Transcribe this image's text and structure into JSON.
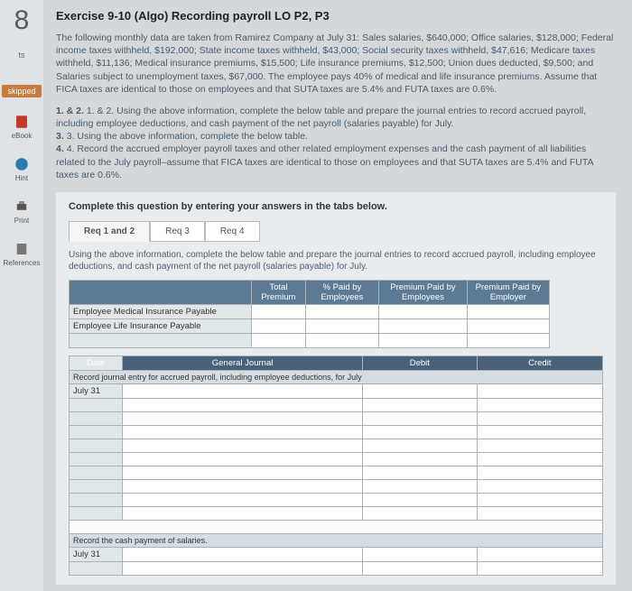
{
  "sidebar": {
    "question_number": "8",
    "points": "ts",
    "badge": "skipped",
    "ebook_label": "eBook",
    "hint_label": "Hint",
    "print_label": "Print",
    "references_label": "References"
  },
  "title": "Exercise 9-10 (Algo) Recording payroll LO P2, P3",
  "intro": "The following monthly data are taken from Ramirez Company at July 31: Sales salaries, $640,000; Office salaries, $128,000; Federal income taxes withheld, $192,000; State income taxes withheld, $43,000; Social security taxes withheld, $47,616; Medicare taxes withheld, $11,136; Medical insurance premiums, $15,500; Life insurance premiums, $12,500; Union dues deducted, $9,500; and Salaries subject to unemployment taxes, $67,000. The employee pays 40% of medical and life insurance premiums. Assume that FICA taxes are identical to those on employees and that SUTA taxes are 5.4% and FUTA taxes are 0.6%.",
  "steps": {
    "s12": "1. & 2. Using the above information, complete the below table and prepare the journal entries to record accrued payroll, including employee deductions, and cash payment of the net payroll (salaries payable) for July.",
    "s3": "3. Using the above information, complete the below table.",
    "s4": "4. Record the accrued employer payroll taxes and other related employment expenses and the cash payment of all liabilities related to the July payroll–assume that FICA taxes are identical to those on employees and that SUTA taxes are 5.4% and FUTA taxes are 0.6%."
  },
  "answer_heading": "Complete this question by entering your answers in the tabs below.",
  "tabs": {
    "t1": "Req 1 and 2",
    "t2": "Req 3",
    "t3": "Req 4"
  },
  "tab_instr": "Using the above information, complete the below table and prepare the journal entries to record accrued payroll, including employee deductions, and cash payment of the net payroll (salaries payable) for July.",
  "table1": {
    "headers": {
      "h1": "Total Premium",
      "h2": "% Paid by Employees",
      "h3": "Premium Paid by Employees",
      "h4": "Premium Paid by Employer"
    },
    "rows": {
      "r1": "Employee Medical Insurance Payable",
      "r2": "Employee Life Insurance Payable"
    }
  },
  "table2": {
    "headers": {
      "date": "Date",
      "gj": "General Journal",
      "debit": "Debit",
      "credit": "Credit"
    },
    "entry1_label": "Record journal entry for accrued payroll, including employee deductions, for July",
    "entry1_date": "July 31",
    "entry2_label": "Record the cash payment of salaries.",
    "entry2_date": "July 31"
  }
}
